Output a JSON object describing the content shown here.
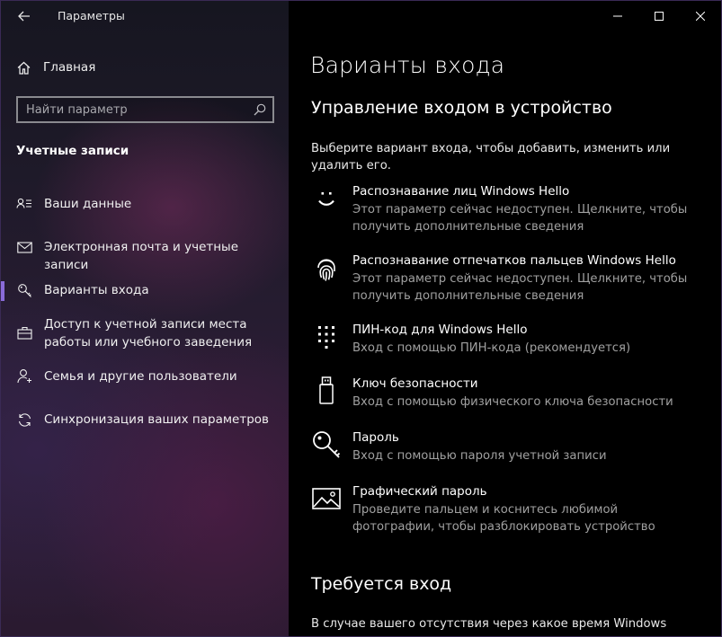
{
  "window": {
    "app_title": "Параметры"
  },
  "sidebar": {
    "home_label": "Главная",
    "search_placeholder": "Найти параметр",
    "section_title": "Учетные записи",
    "items": [
      {
        "label": "Ваши данные",
        "icon": "person-card-icon",
        "active": false
      },
      {
        "label": "Электронная почта и учетные записи",
        "icon": "mail-icon",
        "active": false
      },
      {
        "label": "Варианты входа",
        "icon": "key-icon",
        "active": true
      },
      {
        "label": "Доступ к учетной записи места работы или учебного заведения",
        "icon": "briefcase-icon",
        "active": false
      },
      {
        "label": "Семья и другие пользователи",
        "icon": "add-person-icon",
        "active": false
      },
      {
        "label": "Синхронизация ваших параметров",
        "icon": "sync-icon",
        "active": false
      }
    ],
    "accent_color": "#8a6bd9"
  },
  "main": {
    "page_title": "Варианты входа",
    "manage_title": "Управление входом в устройство",
    "intro_text": "Выберите вариант входа, чтобы добавить, изменить или удалить его.",
    "options": [
      {
        "title": "Распознавание лиц Windows Hello",
        "desc": "Этот параметр сейчас недоступен. Щелкните, чтобы получить дополнительные сведения",
        "icon": "face-icon"
      },
      {
        "title": "Распознавание отпечатков пальцев Windows Hello",
        "desc": "Этот параметр сейчас недоступен. Щелкните, чтобы получить дополнительные сведения",
        "icon": "fingerprint-icon"
      },
      {
        "title": "ПИН-код для Windows Hello",
        "desc": "Вход с помощью ПИН-кода (рекомендуется)",
        "icon": "pin-keypad-icon"
      },
      {
        "title": "Ключ безопасности",
        "desc": "Вход с помощью физического ключа безопасности",
        "icon": "usb-key-icon"
      },
      {
        "title": "Пароль",
        "desc": "Вход с помощью пароля учетной записи",
        "icon": "password-key-icon"
      },
      {
        "title": "Графический пароль",
        "desc": "Проведите пальцем и коснитесь любимой фотографии, чтобы разблокировать устройство",
        "icon": "picture-password-icon"
      }
    ],
    "require_title": "Требуется вход",
    "require_text": "В случае вашего отсутствия через какое время Windows должна"
  }
}
